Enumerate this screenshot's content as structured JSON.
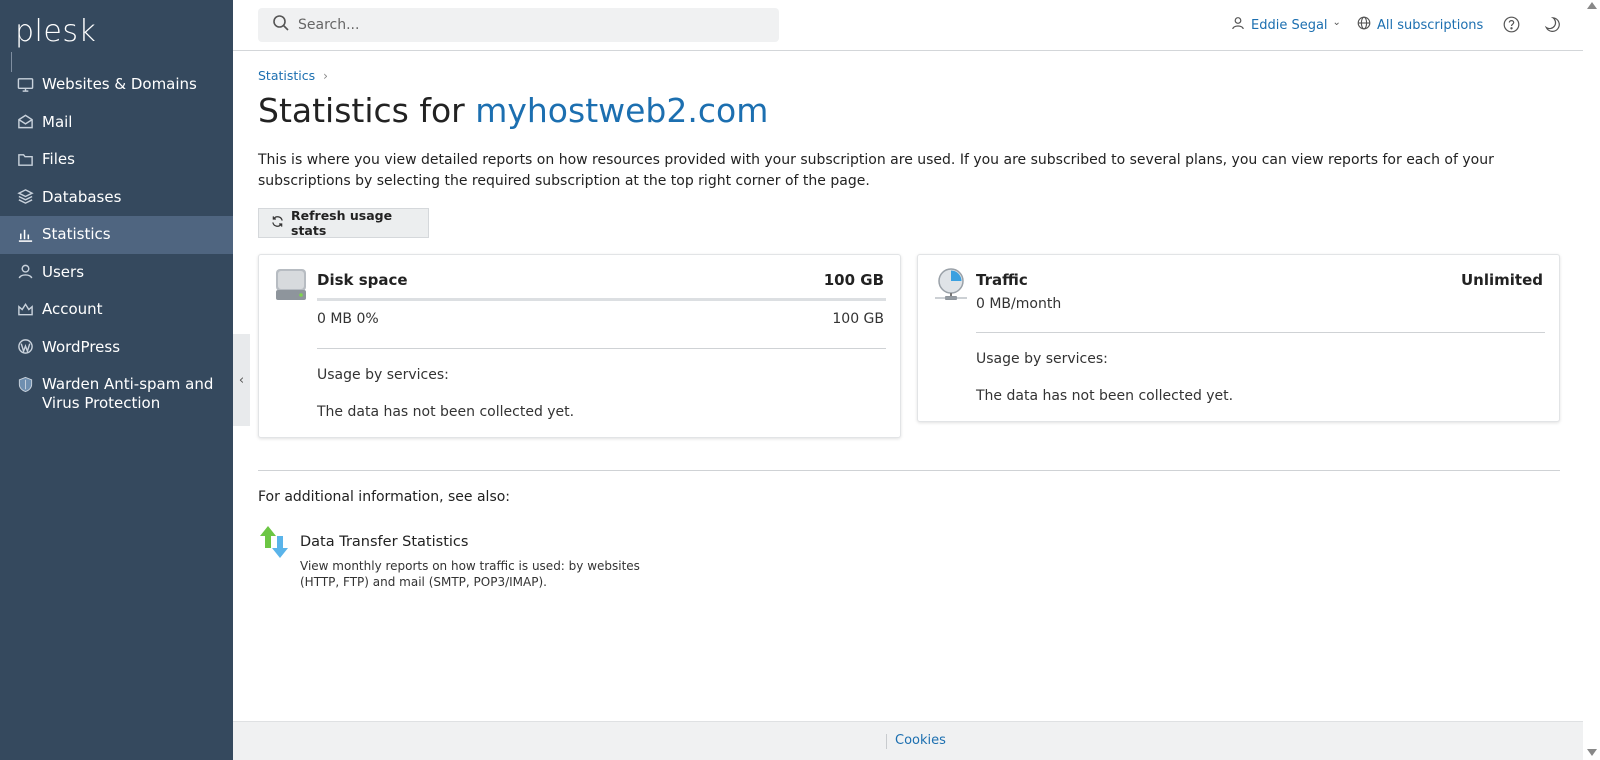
{
  "brand": {
    "logo_text": "plesk"
  },
  "sidebar": {
    "items": [
      {
        "label": "Websites & Domains",
        "icon": "monitor-icon",
        "active": false
      },
      {
        "label": "Mail",
        "icon": "envelope-icon",
        "active": false
      },
      {
        "label": "Files",
        "icon": "folder-icon",
        "active": false
      },
      {
        "label": "Databases",
        "icon": "database-stack-icon",
        "active": false
      },
      {
        "label": "Statistics",
        "icon": "bar-chart-icon",
        "active": true
      },
      {
        "label": "Users",
        "icon": "user-icon",
        "active": false
      },
      {
        "label": "Account",
        "icon": "crown-icon",
        "active": false
      },
      {
        "label": "WordPress",
        "icon": "wordpress-icon",
        "active": false
      },
      {
        "label": "Warden Anti-spam and Virus Protection",
        "icon": "shield-icon",
        "active": false
      }
    ],
    "collapse_glyph": "‹"
  },
  "header": {
    "search_placeholder": "Search...",
    "user_name": "Eddie Segal",
    "user_chevron": "⌄",
    "subscriptions_label": "All subscriptions"
  },
  "breadcrumb": {
    "item": "Statistics",
    "separator": "›"
  },
  "page": {
    "title_prefix": "Statistics for ",
    "title_domain": "myhostweb2.com",
    "description": "This is where you view detailed reports on how resources provided with your subscription are used. If you are subscribed to several plans, you can view reports for each of your subscriptions by selecting the required subscription at the top right corner of the page.",
    "refresh_label": "Refresh usage stats"
  },
  "disk_card": {
    "title": "Disk space",
    "total": "100 GB",
    "used": "0 MB 0%",
    "max": "100 GB",
    "usage_fraction": 0,
    "usage_label": "Usage by services:",
    "no_data": "The data has not been collected yet."
  },
  "traffic_card": {
    "title": "Traffic",
    "total": "Unlimited",
    "usage": "0 MB/month",
    "usage_label": "Usage by services:",
    "no_data": "The data has not been collected yet."
  },
  "see_also": {
    "heading": "For additional information, see also:",
    "links": [
      {
        "title": "Data Transfer Statistics",
        "description": "View monthly reports on how traffic is used: by websites (HTTP, FTP) and mail (SMTP, POP3/IMAP).",
        "icon": "transfer-arrows-icon"
      }
    ]
  },
  "footer": {
    "cookies_label": "Cookies"
  },
  "colors": {
    "sidebar_bg": "#35495e",
    "sidebar_active": "#4f6580",
    "link_blue": "#1c6fb0",
    "progress_blue": "#2e9fe0"
  }
}
